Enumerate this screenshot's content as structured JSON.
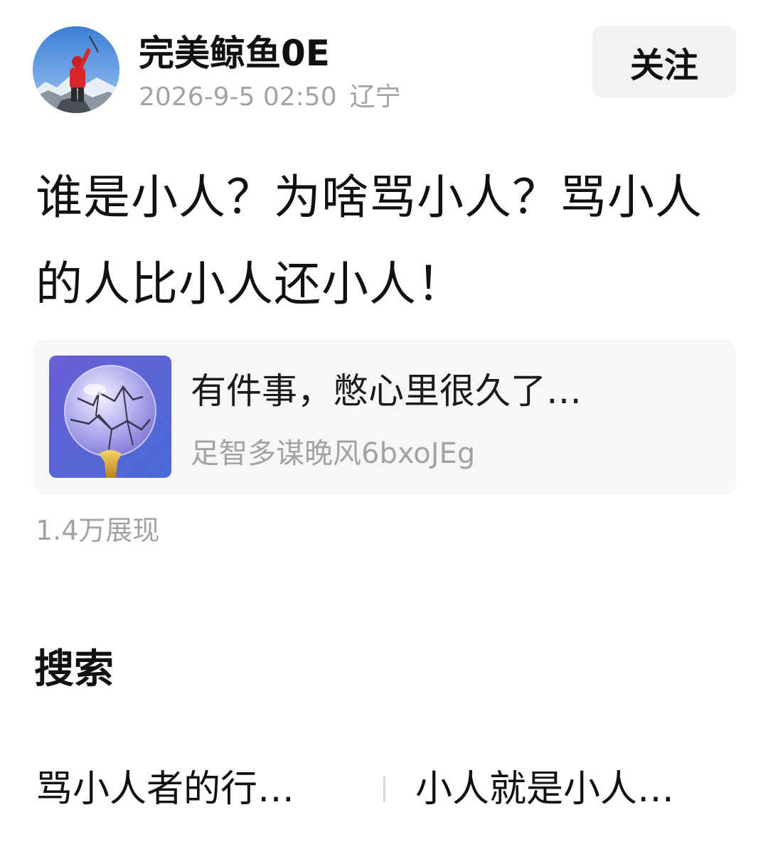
{
  "author": {
    "name": "完美鲸鱼0E",
    "timestamp": "2026-9-5 02:50",
    "location": "辽宁",
    "avatar_icon": "mountain-climber-avatar"
  },
  "follow_button": {
    "label": "关注"
  },
  "post": {
    "title": "谁是小人？为啥骂小人？骂小人的人比小人还小人！",
    "views": "1.4万展现"
  },
  "linked_card": {
    "title": "有件事，憋心里很久了…",
    "source": "足智多谋晚风6bxoJEg",
    "thumbnail_icon": "cracked-glass-sphere-image"
  },
  "search": {
    "heading": "搜索",
    "suggestions": [
      {
        "label": "骂小人者的行…"
      },
      {
        "label": "小人就是小人…"
      }
    ]
  },
  "colors": {
    "text_primary": "#111111",
    "text_secondary": "#a3a3a3",
    "card_background": "#f7f7f7",
    "button_background": "#f2f2f2"
  }
}
